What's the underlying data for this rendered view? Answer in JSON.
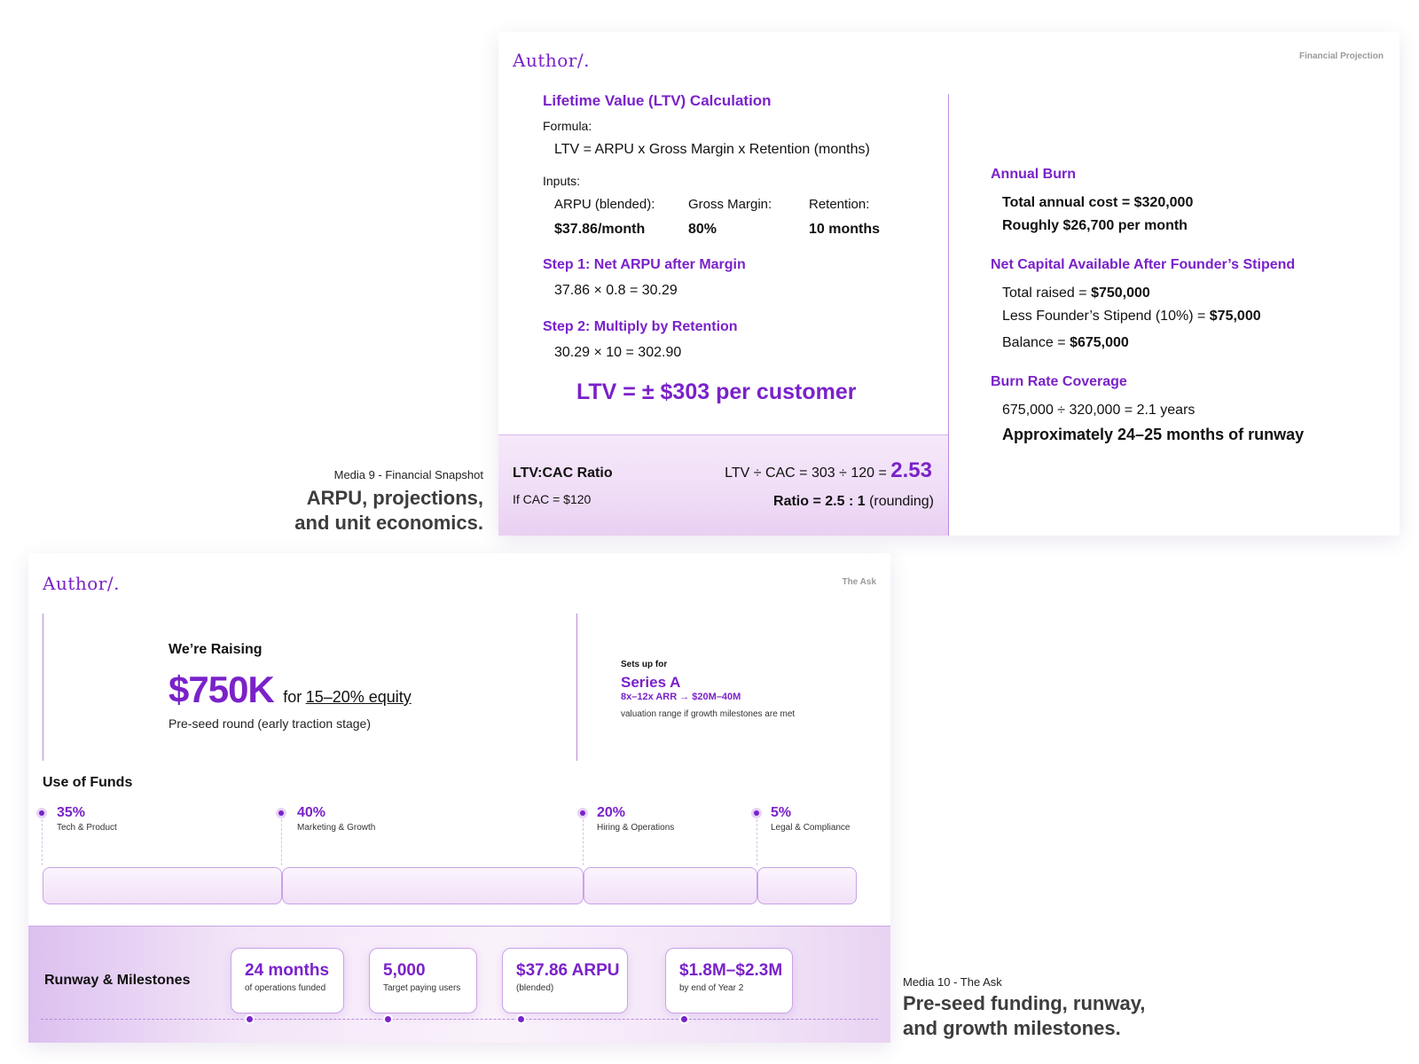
{
  "slide1": {
    "logo": "Author/.",
    "corner_label": "Financial Projection",
    "ltv_title": "Lifetime Value (LTV) Calculation",
    "formula_label": "Formula:",
    "formula": "LTV = ARPU x Gross Margin x Retention (months)",
    "inputs_label": "Inputs:",
    "inputs": [
      {
        "label": "ARPU (blended):",
        "value": "$37.86/month"
      },
      {
        "label": "Gross Margin:",
        "value": "80%"
      },
      {
        "label": "Retention:",
        "value": "10 months"
      }
    ],
    "step1_title": "Step 1: Net ARPU after Margin",
    "step1_calc": "37.86 × 0.8 = 30.29",
    "step2_title": "Step 2: Multiply by Retention",
    "step2_calc": "30.29 × 10 = 302.90",
    "ltv_result": "LTV = ± $303 per customer",
    "ratio_title": "LTV:CAC Ratio",
    "ratio_cac": "If CAC = $120",
    "ratio_calc": "LTV ÷ CAC = 303 ÷ 120 =",
    "ratio_value": "2.53",
    "ratio_bold": "Ratio = 2.5 : 1",
    "ratio_note": "(rounding)",
    "annual_burn_title": "Annual Burn",
    "annual_cost": "Total annual cost = $320,000",
    "monthly_cost": "Roughly $26,700 per month",
    "net_capital_title": "Net Capital Available After Founder’s Stipend",
    "total_raised_label": "Total raised =",
    "total_raised_value": "$750,000",
    "stipend_label": "Less Founder’s Stipend (10%) =",
    "stipend_value": "$75,000",
    "balance_label": "Balance =",
    "balance_value": "$675,000",
    "burn_coverage_title": "Burn Rate Coverage",
    "burn_calc": "675,000 ÷ 320,000 = 2.1 years",
    "runway_text": "Approximately 24–25 months of runway"
  },
  "caption1": {
    "small": "Media 9 - Financial Snapshot",
    "big_line1": "ARPU, projections,",
    "big_line2": "and unit economics."
  },
  "slide2": {
    "logo": "Author/.",
    "corner_label": "The Ask",
    "raising_label": "We’re Raising",
    "amount": "$750K",
    "for_text": "for",
    "equity": "15–20% equity",
    "round_desc": "Pre-seed round (early traction stage)",
    "sets_up_label": "Sets up for",
    "series": "Series A",
    "arr_text": "8x–12x ARR → $20M–40M",
    "valuation_note": "valuation range if growth milestones are met",
    "use_of_funds_title": "Use of Funds",
    "funds": [
      {
        "pct": "35%",
        "label": "Tech & Product"
      },
      {
        "pct": "40%",
        "label": "Marketing & Growth"
      },
      {
        "pct": "20%",
        "label": "Hiring & Operations"
      },
      {
        "pct": "5%",
        "label": "Legal & Compliance"
      }
    ],
    "runway_title": "Runway & Milestones",
    "milestones": [
      {
        "value": "24 months",
        "caption": "of operations funded"
      },
      {
        "value": "5,000",
        "caption": "Target paying users"
      },
      {
        "value": "$37.86 ARPU",
        "caption": "(blended)"
      },
      {
        "value": "$1.8M–$2.3M",
        "caption": "by end of Year 2"
      }
    ]
  },
  "caption2": {
    "small": "Media 10 - The Ask",
    "big_line1": "Pre-seed funding, runway,",
    "big_line2": "and growth milestones."
  },
  "colors": {
    "accent": "#7a22c9",
    "panel": "#f1e0f7"
  }
}
